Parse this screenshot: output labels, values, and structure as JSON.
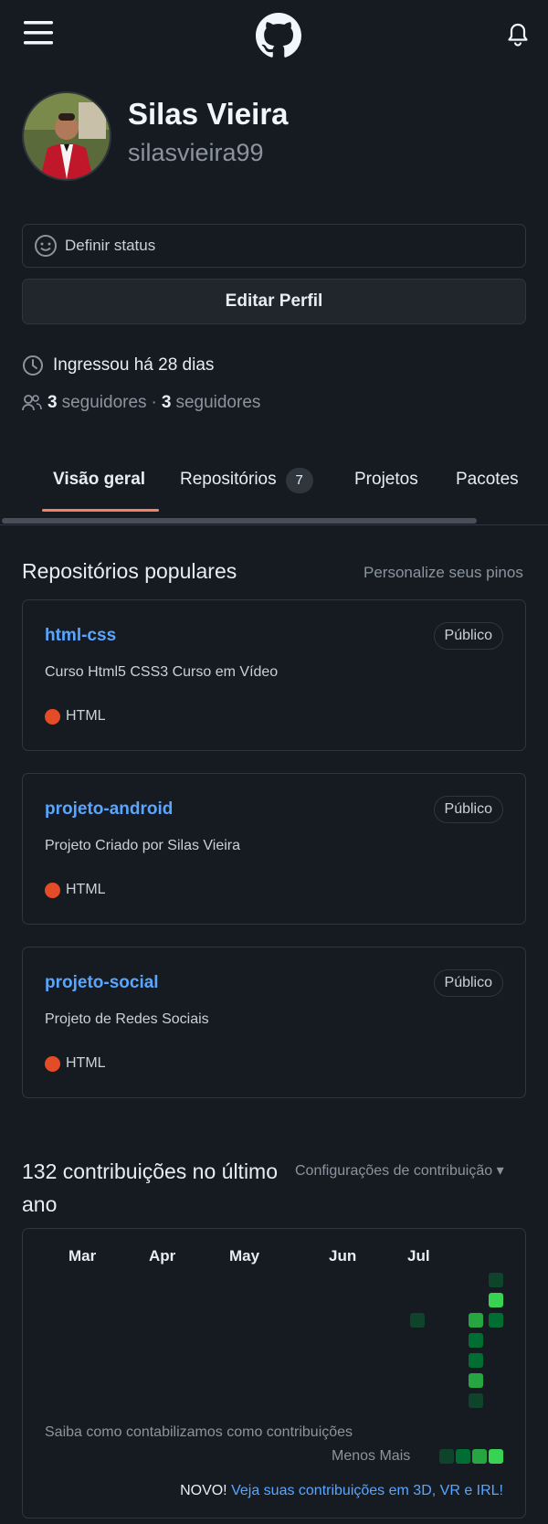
{
  "header": {
    "menu_icon": "hamburger-menu-icon",
    "logo_icon": "github-logo-icon",
    "bell_icon": "notification-bell-icon"
  },
  "profile": {
    "name": "Silas Vieira",
    "username": "silasvieira99",
    "status_label": "Definir status",
    "edit_label": "Editar Perfil",
    "joined": "Ingressou há 28 dias",
    "followers_count": "3",
    "followers_label": "seguidores",
    "separator": "·",
    "following_count": "3",
    "following_label": "seguidores"
  },
  "tabs": [
    {
      "label": "Visão geral",
      "active": true
    },
    {
      "label": "Repositórios",
      "count": "7"
    },
    {
      "label": "Projetos"
    },
    {
      "label": "Pacotes"
    }
  ],
  "popular": {
    "title": "Repositórios populares",
    "customize": "Personalize seus pinos",
    "repos": [
      {
        "name": "html-css",
        "badge": "Público",
        "description": "Curso Html5 CSS3 Curso em Vídeo",
        "language": "HTML"
      },
      {
        "name": "projeto-android",
        "badge": "Público",
        "description": "Projeto Criado por Silas Vieira",
        "language": "HTML"
      },
      {
        "name": "projeto-social",
        "badge": "Público",
        "description": "Projeto de Redes Sociais",
        "language": "HTML"
      }
    ]
  },
  "contributions": {
    "title": "132 contribuições no último ano",
    "settings": "Configurações de contribuição ▾",
    "months": [
      "Mar",
      "Apr",
      "May",
      "Jun",
      "Jul"
    ],
    "learn": "Saiba como contabilizamos como contribuições",
    "legend": "Menos Mais",
    "new_label": "NOVO!",
    "new_link": "Veja suas contribuições em 3D, VR e IRL!"
  },
  "colors": {
    "background": "#161b22",
    "accent_tab": "#f78166",
    "link": "#58a6ff",
    "html_lang": "#e34c26",
    "contrib_levels": [
      "#0e4429",
      "#006d32",
      "#26a641",
      "#39d353"
    ]
  }
}
